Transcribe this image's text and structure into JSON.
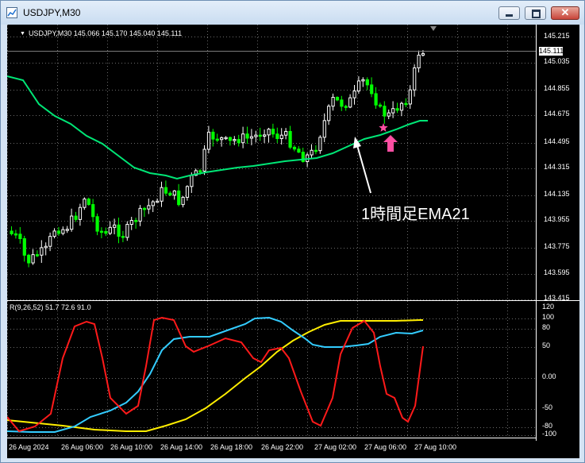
{
  "window": {
    "title": "USDJPY,M30"
  },
  "main_panel": {
    "header": "USDJPY,M30  145.066 145.170 145.040 145.111",
    "current_price": "145.111",
    "price_axis": [
      "145.215",
      "145.035",
      "144.855",
      "144.675",
      "144.495",
      "144.315",
      "144.135",
      "143.955",
      "143.775",
      "143.595",
      "143.415"
    ],
    "annotation": "1時間足EMA21"
  },
  "oscillator": {
    "header": "R(9,26,52) 51.7 72.6 91.0",
    "axis": [
      "120",
      "100",
      "80",
      "50",
      "0.00",
      "-50",
      "-80",
      "-100"
    ]
  },
  "time_axis": [
    "26 Aug 2024",
    "26 Aug 06:00",
    "26 Aug 10:00",
    "26 Aug 14:00",
    "26 Aug 18:00",
    "26 Aug 22:00",
    "27 Aug 02:00",
    "27 Aug 06:00",
    "27 Aug 10:00"
  ],
  "colors": {
    "candle_up": "#ffffff",
    "candle_down": "#00ff00",
    "ema": "#00e676",
    "rci_short": "#ff1a1a",
    "rci_mid": "#33ccff",
    "rci_long": "#ffee00",
    "marker": "#ff4fa3"
  },
  "icons": {
    "marker": "star",
    "arrow": "up-arrow"
  }
}
